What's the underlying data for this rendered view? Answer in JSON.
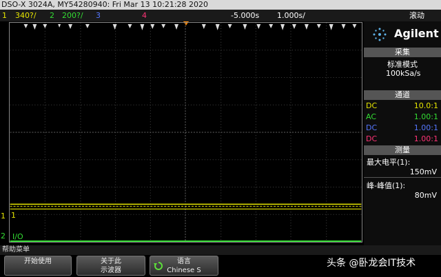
{
  "title_bar": {
    "device": "DSO-X 3024A, MY54280940: Fri Mar 13 10:21:28 2020"
  },
  "channel_bar": {
    "ch1_num": "1",
    "ch1_scale": "340?/",
    "ch2_num": "2",
    "ch2_scale": "200?/",
    "ch3_num": "3",
    "ch4_num": "4",
    "timebase_pos": "-5.000s",
    "timebase_scale": "1.000s/",
    "run_state": "滚动"
  },
  "brand": {
    "name": "Agilent"
  },
  "acquire": {
    "header": "采集",
    "mode": "标准模式",
    "rate": "100kSa/s"
  },
  "channels": {
    "header": "通道",
    "rows": [
      {
        "coupling": "DC",
        "ratio": "10.0:1",
        "color": "#e6e600"
      },
      {
        "coupling": "AC",
        "ratio": "1.00:1",
        "color": "#33dd33"
      },
      {
        "coupling": "DC",
        "ratio": "1.00:1",
        "color": "#5577ff"
      },
      {
        "coupling": "DC",
        "ratio": "1.00:1",
        "color": "#ff3377"
      }
    ]
  },
  "measure": {
    "header": "测量",
    "item1_label": "最大电平(1):",
    "item1_value": "150mV",
    "item2_label": "峰-峰值(1):",
    "item2_value": "80mV"
  },
  "markers": {
    "ch1": "1",
    "ch2": "2",
    "io_label": "I/O"
  },
  "help_bar": {
    "label": "帮助菜单"
  },
  "softkeys": {
    "k1_line1": "开始使用",
    "k2_line1": "关于此",
    "k2_line2": "示波器",
    "k3_line1": "语言",
    "k3_line2": "Chinese S"
  },
  "watermark": "头条 @卧龙会IT技术",
  "colors": {
    "ch1": "#e6e600",
    "ch2": "#33dd33",
    "ch3": "#5577ff",
    "ch4": "#ff3377",
    "trigger_marker": "#ff8800",
    "section_header": "#555555"
  }
}
